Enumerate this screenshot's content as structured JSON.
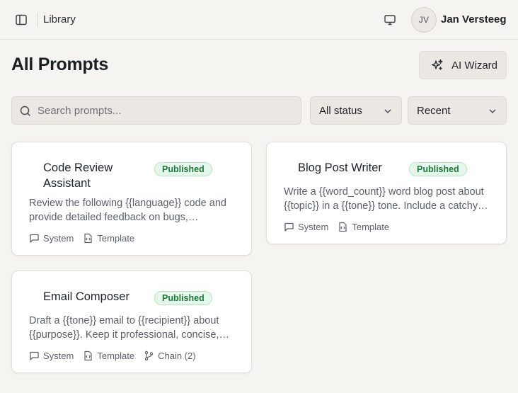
{
  "header": {
    "breadcrumb": "Library",
    "user": {
      "initials": "JV",
      "name": "Jan Versteeg"
    }
  },
  "page": {
    "title": "All Prompts",
    "wizard_label": "AI Wizard"
  },
  "filters": {
    "search_placeholder": "Search prompts...",
    "status_selected": "All status",
    "sort_selected": "Recent"
  },
  "colors": {
    "background": "#f6f4f1",
    "badge_bg": "#e5f7ea",
    "badge_text": "#1c7a3a"
  },
  "prompts": [
    {
      "title": "Code Review Assistant",
      "status": "Published",
      "description": "Review the following {{language}} code and provide detailed feedback on bugs, performance, and style.",
      "tags": [
        "System",
        "Template"
      ]
    },
    {
      "title": "Blog Post Writer",
      "status": "Published",
      "description": "Write a {{word_count}} word blog post about {{topic}} in a {{tone}} tone. Include a catchy title.",
      "tags": [
        "System",
        "Template"
      ]
    },
    {
      "title": "Email Composer",
      "status": "Published",
      "description": "Draft a {{tone}} email to {{recipient}} about {{purpose}}. Keep it professional, concise, and clear.",
      "tags": [
        "System",
        "Template",
        "Chain (2)"
      ]
    }
  ]
}
